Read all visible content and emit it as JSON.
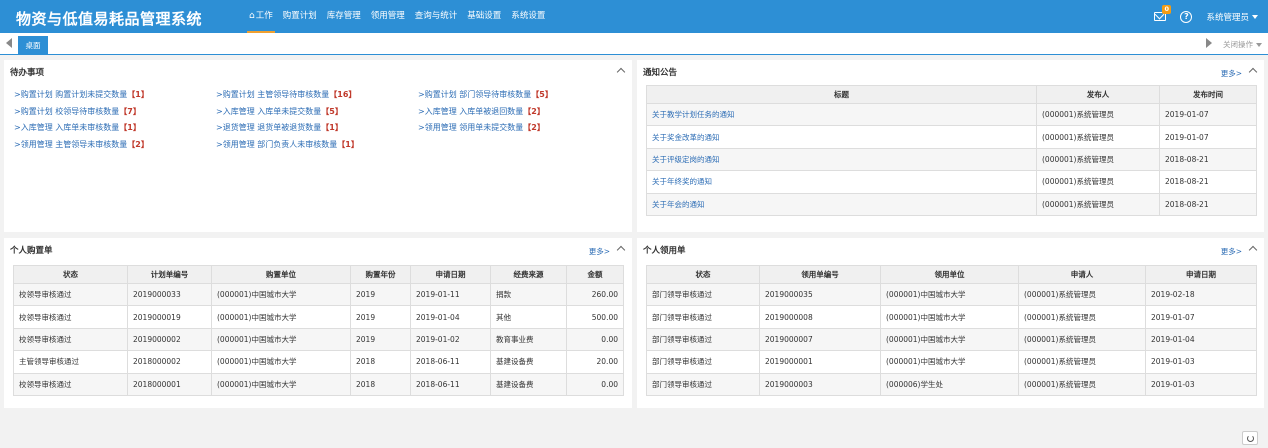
{
  "app": {
    "title": "物资与低值易耗品管理系统"
  },
  "nav": [
    "工作",
    "购置计划",
    "库存管理",
    "领用管理",
    "查询与统计",
    "基础设置",
    "系统设置"
  ],
  "topRight": {
    "mailCount": "0",
    "user": "系统管理员"
  },
  "tabs": {
    "active": "桌面",
    "closeOps": "关闭操作"
  },
  "todo": {
    "title": "待办事项",
    "items": [
      [
        {
          "text": ">购置计划 购置计划未提交数量",
          "count": "【1】"
        },
        {
          "text": ">购置计划 主管领导待审核数量",
          "count": "【16】"
        },
        {
          "text": ">购置计划 部门领导待审核数量",
          "count": "【5】"
        }
      ],
      [
        {
          "text": ">购置计划 校领导待审核数量",
          "count": "【7】"
        },
        {
          "text": ">入库管理 入库单未提交数量",
          "count": "【5】"
        },
        {
          "text": ">入库管理 入库单被退回数量",
          "count": "【2】"
        }
      ],
      [
        {
          "text": ">入库管理 入库单未审核数量",
          "count": "【1】"
        },
        {
          "text": ">退货管理 退货单被退货数量",
          "count": "【1】"
        },
        {
          "text": ">领用管理 领用单未提交数量",
          "count": "【2】"
        }
      ],
      [
        {
          "text": ">领用管理 主管领导未审核数量",
          "count": "【2】"
        },
        {
          "text": ">领用管理 部门负责人未审核数量",
          "count": "【1】"
        }
      ]
    ]
  },
  "notice": {
    "title": "通知公告",
    "more": "更多>",
    "headers": [
      "标题",
      "发布人",
      "发布时间"
    ],
    "rows": [
      [
        "关于教学计划任务的通知",
        "(000001)系统管理员",
        "2019-01-07"
      ],
      [
        "关于奖金改革的通知",
        "(000001)系统管理员",
        "2019-01-07"
      ],
      [
        "关于评级定岗的通知",
        "(000001)系统管理员",
        "2018-08-21"
      ],
      [
        "关于年终奖的通知",
        "(000001)系统管理员",
        "2018-08-21"
      ],
      [
        "关于年会的通知",
        "(000001)系统管理员",
        "2018-08-21"
      ]
    ]
  },
  "purchase": {
    "title": "个人购置单",
    "more": "更多>",
    "headers": [
      "状态",
      "计划单编号",
      "购置单位",
      "购置年份",
      "申请日期",
      "经费来源",
      "金额"
    ],
    "rows": [
      [
        "校领导审核通过",
        "2019000033",
        "(000001)中国城市大学",
        "2019",
        "2019-01-11",
        "捐款",
        "260.00"
      ],
      [
        "校领导审核通过",
        "2019000019",
        "(000001)中国城市大学",
        "2019",
        "2019-01-04",
        "其他",
        "500.00"
      ],
      [
        "校领导审核通过",
        "2019000002",
        "(000001)中国城市大学",
        "2019",
        "2019-01-02",
        "教育事业费",
        "0.00"
      ],
      [
        "主管领导审核通过",
        "2018000002",
        "(000001)中国城市大学",
        "2018",
        "2018-06-11",
        "基建设备费",
        "20.00"
      ],
      [
        "校领导审核通过",
        "2018000001",
        "(000001)中国城市大学",
        "2018",
        "2018-06-11",
        "基建设备费",
        "0.00"
      ]
    ]
  },
  "requisition": {
    "title": "个人领用单",
    "more": "更多>",
    "headers": [
      "状态",
      "领用单编号",
      "领用单位",
      "申请人",
      "申请日期"
    ],
    "rows": [
      [
        "部门领导审核通过",
        "2019000035",
        "(000001)中国城市大学",
        "(000001)系统管理员",
        "2019-02-18"
      ],
      [
        "部门领导审核通过",
        "2019000008",
        "(000001)中国城市大学",
        "(000001)系统管理员",
        "2019-01-07"
      ],
      [
        "部门领导审核通过",
        "2019000007",
        "(000001)中国城市大学",
        "(000001)系统管理员",
        "2019-01-04"
      ],
      [
        "部门领导审核通过",
        "2019000001",
        "(000001)中国城市大学",
        "(000001)系统管理员",
        "2019-01-03"
      ],
      [
        "部门领导审核通过",
        "2019000003",
        "(000006)学生处",
        "(000001)系统管理员",
        "2019-01-03"
      ]
    ]
  }
}
